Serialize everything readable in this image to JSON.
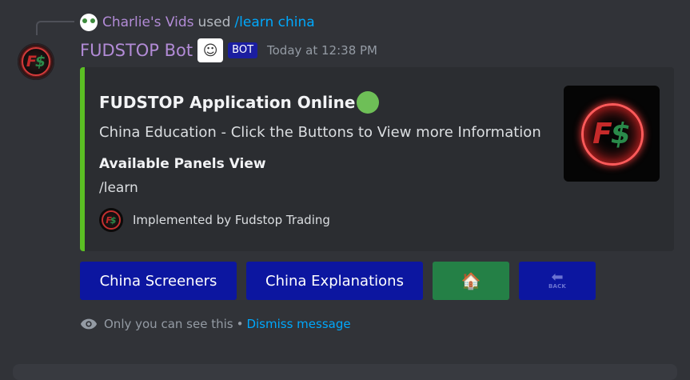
{
  "reply": {
    "user": "Charlie's Vids",
    "used": "used",
    "command": "/learn china"
  },
  "message": {
    "author": "FUDSTOP Bot",
    "bot_tag": "BOT",
    "timestamp": "Today at 12:38 PM"
  },
  "embed": {
    "accent_color": "#5bbf23",
    "title": "FUDSTOP Application Online",
    "description": "China Education - Click the Buttons to View more Information",
    "field_name": "Available Panels View",
    "field_value": "/learn",
    "footer": "Implemented by Fudstop Trading"
  },
  "buttons": [
    {
      "label": "China Screeners",
      "style": "primary"
    },
    {
      "label": "China Explanations",
      "style": "primary"
    },
    {
      "label": "",
      "icon": "house-icon",
      "style": "success"
    },
    {
      "label": "",
      "icon": "back-icon",
      "icon_text": "BACK",
      "style": "primary"
    }
  ],
  "ephemeral": {
    "text": "Only you can see this",
    "separator": "•",
    "dismiss": "Dismiss message"
  }
}
